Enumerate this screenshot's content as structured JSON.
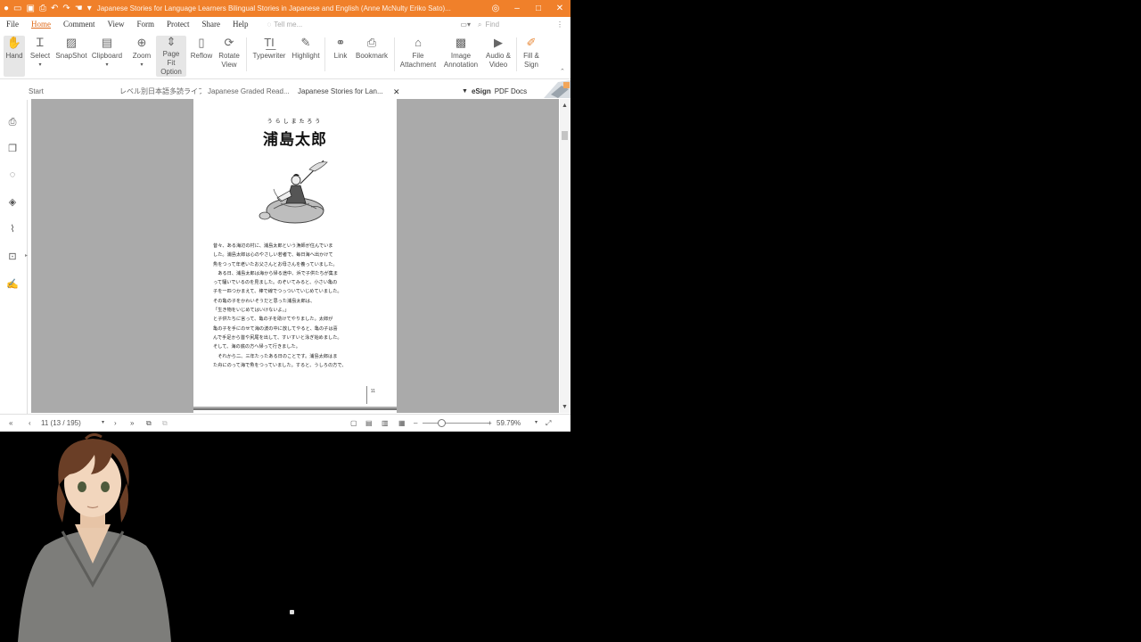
{
  "title_bar": {
    "title": "Japanese Stories for Language Learners Bilingual Stories in Japanese and English (Anne McNulty Eriko Sato)...",
    "window_controls": [
      "–",
      "□",
      "✕"
    ]
  },
  "menu": {
    "items": [
      "File",
      "Home",
      "Comment",
      "View",
      "Form",
      "Protect",
      "Share",
      "Help"
    ],
    "active": "Home",
    "tell_me_placeholder": "Tell me...",
    "find_placeholder": "Find"
  },
  "ribbon": {
    "buttons": [
      {
        "label": "Hand",
        "icon": "hand-icon"
      },
      {
        "label": "Select",
        "icon": "select-icon"
      },
      {
        "label": "SnapShot",
        "icon": "snapshot-icon"
      },
      {
        "label": "Clipboard",
        "icon": "clipboard-icon"
      },
      {
        "label": "Zoom",
        "icon": "zoom-icon"
      },
      {
        "label": "Page Fit Option",
        "icon": "page-fit-icon"
      },
      {
        "label": "Reflow",
        "icon": "reflow-icon"
      },
      {
        "label": "Rotate View",
        "icon": "rotate-icon"
      },
      {
        "label": "Typewriter",
        "icon": "typewriter-icon"
      },
      {
        "label": "Highlight",
        "icon": "highlight-icon"
      },
      {
        "label": "Link",
        "icon": "link-icon"
      },
      {
        "label": "Bookmark",
        "icon": "bookmark-icon"
      },
      {
        "label": "File Attachment",
        "icon": "file-attachment-icon"
      },
      {
        "label": "Image Annotation",
        "icon": "image-annotation-icon"
      },
      {
        "label": "Audio & Video",
        "icon": "audio-video-icon"
      },
      {
        "label": "Fill & Sign",
        "icon": "fill-sign-icon"
      }
    ]
  },
  "tabs": {
    "items": [
      "Start",
      "レベル別日本語多読ライブ...",
      "Japanese Graded Read...",
      "Japanese Stories for Lan..."
    ],
    "active_index": 3,
    "esign_label": "eSign",
    "esign_suffix": "PDF Docs"
  },
  "document": {
    "furigana": "うらしまたろう",
    "title": "浦島太郎",
    "page_number": "11",
    "lines": [
      "昔々、ある海辺の村に、浦島太郎という漁師が住んでいま",
      "した。浦島太郎は心のやさしい若者で、毎日海へ出かけて",
      "魚をつって年老いたお父さんとお母さんを養っていました。",
      "　ある日、浦島太郎は海から帰る途中、浜で子供たちが集ま",
      "って騒いでいるのを見ました。のぞいてみると、小さい亀の",
      "子を一匹つかまえて、棒で線でつっついていじめていました。",
      "その亀の子をかわいそうだと思った浦島太郎は、",
      "「生き物をいじめてはいけないよ。」",
      "と子供たちに言って、亀の子を助けてやりました。太郎が",
      "亀の子を手にのせて海の波の中に放してやると、亀の子は喜",
      "んで手足から首や尻尾を出して、すいすいと泳ぎ始めました。",
      "そして、海の底の方へ帰って行きました。",
      "　それから二、三年たったある日のことです。浦島太郎はま",
      "た舟にのって海で魚をつっていました。すると、うしろの方で、"
    ]
  },
  "status": {
    "page_field": "11 (13 / 195)",
    "zoom": "59.79%",
    "zoom_fraction": 0.28
  }
}
